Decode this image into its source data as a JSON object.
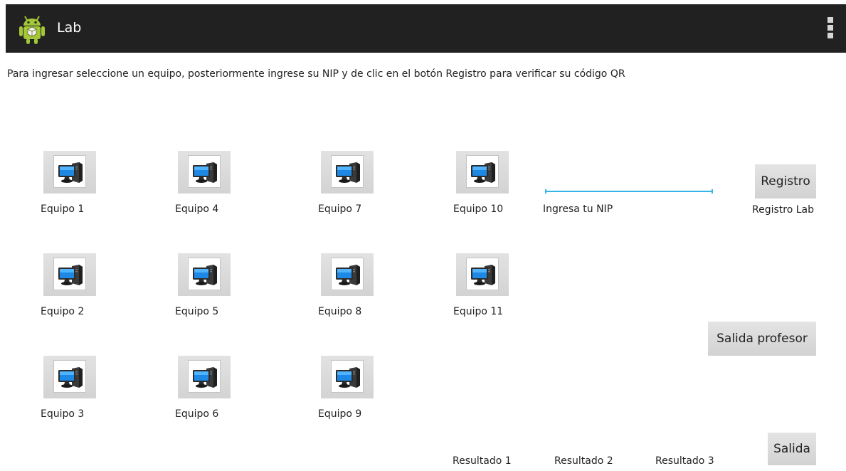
{
  "app": {
    "title": "Lab",
    "icon": "android-robot-icon"
  },
  "instructions": "Para ingresar seleccione un equipo, posteriormente ingrese su NIP y de clic en el botón Registro para verificar su código QR",
  "equipos": [
    {
      "label": "Equipo 1",
      "icon": "computer-icon"
    },
    {
      "label": "Equipo 2",
      "icon": "computer-icon"
    },
    {
      "label": "Equipo 3",
      "icon": "computer-icon"
    },
    {
      "label": "Equipo 4",
      "icon": "computer-icon"
    },
    {
      "label": "Equipo 5",
      "icon": "computer-icon"
    },
    {
      "label": "Equipo 6",
      "icon": "computer-icon"
    },
    {
      "label": "Equipo 7",
      "icon": "computer-icon"
    },
    {
      "label": "Equipo 8",
      "icon": "computer-icon"
    },
    {
      "label": "Equipo 9",
      "icon": "computer-icon"
    },
    {
      "label": "Equipo 10",
      "icon": "computer-icon"
    },
    {
      "label": "Equipo 11",
      "icon": "computer-icon"
    }
  ],
  "nip": {
    "value": "",
    "label": "Ingresa tu NIP"
  },
  "buttons": {
    "registro": "Registro",
    "registro_lab": "Registro Lab",
    "salida_profesor": "Salida profesor",
    "salida": "Salida"
  },
  "resultados": [
    "Resultado 1",
    "Resultado 2",
    "Resultado 3"
  ],
  "colors": {
    "actionbar": "#212121",
    "accent": "#33b5e5",
    "button": "#d9d9d9",
    "android_green": "#a4c639"
  }
}
